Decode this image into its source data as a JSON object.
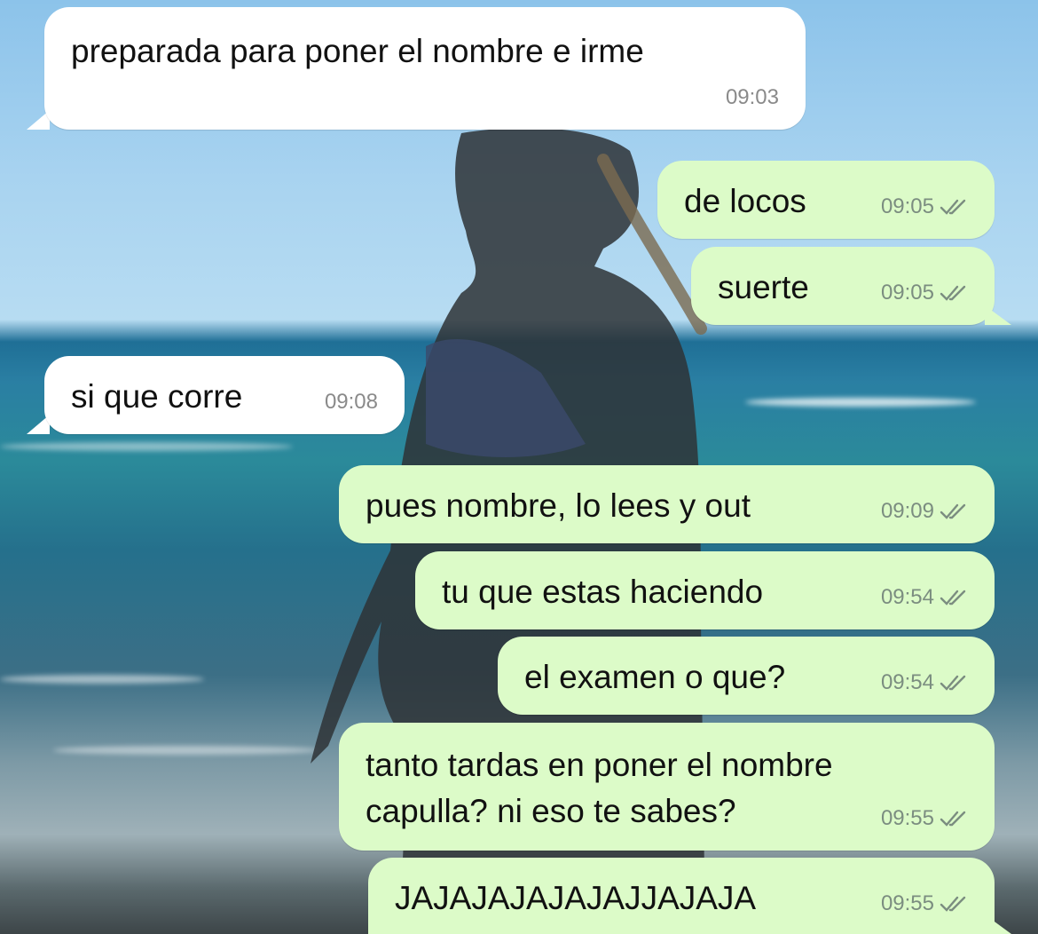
{
  "colors": {
    "incoming_bubble": "#ffffff",
    "outgoing_bubble": "#dcfbc8",
    "timestamp": "#7b8d80",
    "text": "#111111"
  },
  "messages": [
    {
      "direction": "incoming",
      "text": "preparada para poner el nombre e irme",
      "time": "09:03",
      "read_icon": "none"
    },
    {
      "direction": "outgoing",
      "text": "de locos",
      "time": "09:05",
      "read_icon": "double-check-icon"
    },
    {
      "direction": "outgoing",
      "text": "suerte",
      "time": "09:05",
      "read_icon": "double-check-icon"
    },
    {
      "direction": "incoming",
      "text": "si que corre",
      "time": "09:08",
      "read_icon": "none"
    },
    {
      "direction": "outgoing",
      "text": "pues nombre, lo lees y out",
      "time": "09:09",
      "read_icon": "double-check-icon"
    },
    {
      "direction": "outgoing",
      "text": "tu que estas haciendo",
      "time": "09:54",
      "read_icon": "double-check-icon"
    },
    {
      "direction": "outgoing",
      "text": "el examen o que?",
      "time": "09:54",
      "read_icon": "double-check-icon"
    },
    {
      "direction": "outgoing",
      "text": "tanto tardas en poner el nombre\ncapulla? ni eso te sabes?",
      "time": "09:55",
      "read_icon": "double-check-icon"
    },
    {
      "direction": "outgoing",
      "text": "JAJAJAJAJAJAJJAJAJA",
      "time": "09:55",
      "read_icon": "double-check-icon"
    }
  ]
}
